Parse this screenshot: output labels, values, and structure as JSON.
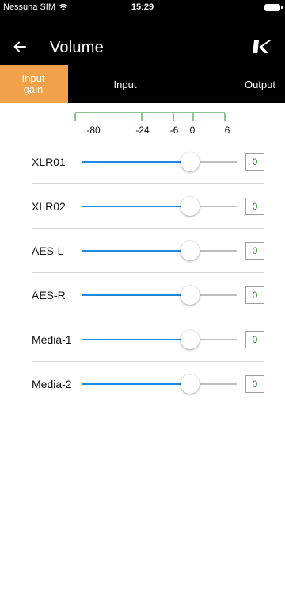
{
  "status_bar": {
    "carrier": "Nessuna SIM",
    "time": "15:29"
  },
  "nav": {
    "title": "Volume",
    "logo": "K"
  },
  "tabs": [
    {
      "label": "Input\ngain",
      "active": true
    },
    {
      "label": "Input",
      "active": false
    },
    {
      "label": "Output",
      "active": false
    }
  ],
  "scale": {
    "ticks": [
      "-80",
      "-24",
      "-6",
      "0",
      "6"
    ]
  },
  "channels": [
    {
      "label": "XLR01",
      "value": "0",
      "level": 0.7
    },
    {
      "label": "XLR02",
      "value": "0",
      "level": 0.7
    },
    {
      "label": "AES-L",
      "value": "0",
      "level": 0.7
    },
    {
      "label": "AES-R",
      "value": "0",
      "level": 0.7
    },
    {
      "label": "Media-1",
      "value": "0",
      "level": 0.7
    },
    {
      "label": "Media-2",
      "value": "0",
      "level": 0.7
    }
  ],
  "colors": {
    "accent": "#f0a14a",
    "slider": "#1e88e5",
    "value": "#1b8a1b",
    "scale": "#43a047"
  },
  "icons": {
    "back": "arrow-left-icon",
    "wifi": "wifi-icon",
    "battery": "battery-icon"
  }
}
